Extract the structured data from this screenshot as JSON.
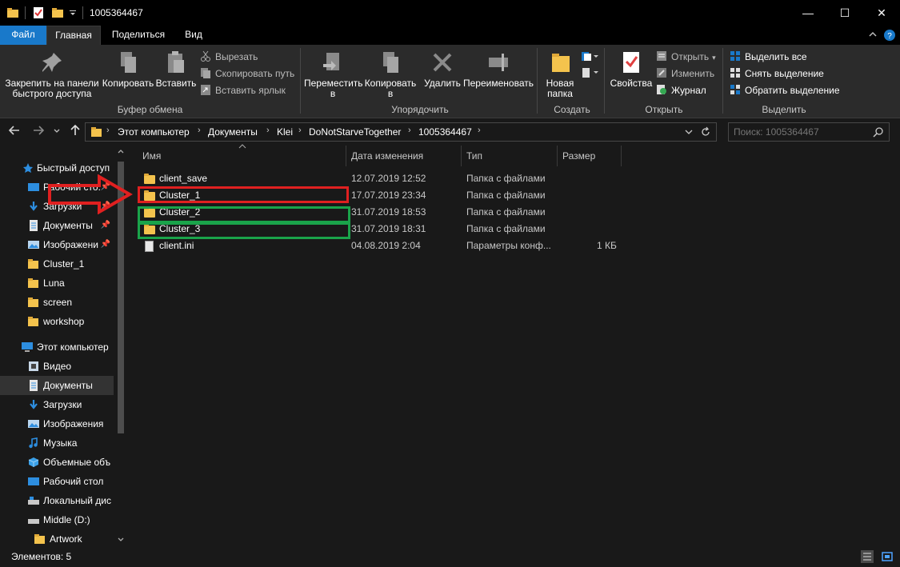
{
  "window": {
    "title": "1005364467",
    "minimize": "—",
    "maximize": "☐",
    "close": "✕"
  },
  "ribbon_tabs": [
    "Файл",
    "Главная",
    "Поделиться",
    "Вид"
  ],
  "ribbon": {
    "clipboard": {
      "pin": "Закрепить на панели быстрого доступа",
      "pin_line1": "Закрепить на панели",
      "pin_line2": "быстрого доступа",
      "copy": "Копировать",
      "paste": "Вставить",
      "cut": "Вырезать",
      "copy_path": "Скопировать путь",
      "paste_shortcut": "Вставить ярлык",
      "group": "Буфер обмена"
    },
    "organize": {
      "move_line1": "Переместить",
      "move_line2": "в",
      "copy_line1": "Копировать",
      "copy_line2": "в",
      "delete": "Удалить",
      "rename": "Переименовать",
      "group": "Упорядочить"
    },
    "new": {
      "new_folder_line1": "Новая",
      "new_folder_line2": "папка",
      "group": "Создать"
    },
    "open": {
      "properties": "Свойства",
      "open": "Открыть",
      "edit": "Изменить",
      "history": "Журнал",
      "group": "Открыть"
    },
    "select": {
      "select_all": "Выделить все",
      "select_none": "Снять выделение",
      "invert": "Обратить выделение",
      "group": "Выделить"
    }
  },
  "address": {
    "crumbs": [
      "Этот компьютер",
      "Документы",
      "Klei",
      "DoNotStarveTogether",
      "1005364467"
    ],
    "search_placeholder": "Поиск: 1005364467"
  },
  "nav": [
    {
      "label": "Быстрый доступ",
      "icon": "star-icon",
      "pinned": false
    },
    {
      "label": "Рабочий сто.",
      "icon": "desktop-icon",
      "pinned": true
    },
    {
      "label": "Загрузки",
      "icon": "download-icon",
      "pinned": true
    },
    {
      "label": "Документы",
      "icon": "documents-icon",
      "pinned": true
    },
    {
      "label": "Изображени",
      "icon": "pictures-icon",
      "pinned": true
    },
    {
      "label": "Cluster_1",
      "icon": "folder-icon",
      "pinned": false
    },
    {
      "label": "Luna",
      "icon": "folder-icon",
      "pinned": false
    },
    {
      "label": "screen",
      "icon": "folder-icon",
      "pinned": false
    },
    {
      "label": "workshop",
      "icon": "folder-icon",
      "pinned": false
    },
    {
      "label": "Этот компьютер",
      "icon": "computer-icon",
      "pinned": false
    },
    {
      "label": "Видео",
      "icon": "video-icon",
      "pinned": false
    },
    {
      "label": "Документы",
      "icon": "documents-icon",
      "pinned": false
    },
    {
      "label": "Загрузки",
      "icon": "download-icon",
      "pinned": false
    },
    {
      "label": "Изображения",
      "icon": "pictures-icon",
      "pinned": false
    },
    {
      "label": "Музыка",
      "icon": "music-icon",
      "pinned": false
    },
    {
      "label": "Объемные объ",
      "icon": "3d-objects-icon",
      "pinned": false
    },
    {
      "label": "Рабочий стол",
      "icon": "desktop-icon",
      "pinned": false
    },
    {
      "label": "Локальный дис",
      "icon": "drive-icon",
      "pinned": false
    },
    {
      "label": "Middle (D:)",
      "icon": "drive-icon",
      "pinned": false
    },
    {
      "label": "Artwork",
      "icon": "folder-icon",
      "pinned": false
    }
  ],
  "columns": {
    "name": "Имя",
    "date": "Дата изменения",
    "type": "Тип",
    "size": "Размер"
  },
  "files": [
    {
      "name": "client_save",
      "date": "12.07.2019 12:52",
      "type": "Папка с файлами",
      "size": "",
      "kind": "folder"
    },
    {
      "name": "Cluster_1",
      "date": "17.07.2019 23:34",
      "type": "Папка с файлами",
      "size": "",
      "kind": "folder"
    },
    {
      "name": "Cluster_2",
      "date": "31.07.2019 18:53",
      "type": "Папка с файлами",
      "size": "",
      "kind": "folder"
    },
    {
      "name": "Cluster_3",
      "date": "31.07.2019 18:31",
      "type": "Папка с файлами",
      "size": "",
      "kind": "folder"
    },
    {
      "name": "client.ini",
      "date": "04.08.2019 2:04",
      "type": "Параметры конф...",
      "size": "1 КБ",
      "kind": "file"
    }
  ],
  "annotations": {
    "red_color": "#e02020",
    "green_color": "#1aa34a"
  },
  "status": {
    "items_count": "Элементов: 5"
  },
  "colors": {
    "accent": "#1979ca",
    "background": "#191919",
    "ribbon": "#2b2b2b"
  }
}
